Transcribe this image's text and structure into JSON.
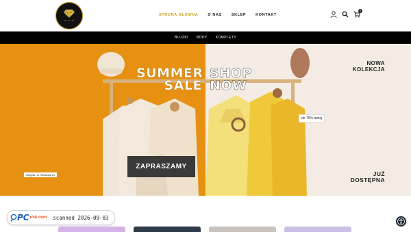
{
  "header": {
    "nav": [
      {
        "label": "STRONA GŁÓWNA",
        "active": true
      },
      {
        "label": "O NAS",
        "active": false
      },
      {
        "label": "SKLEP",
        "active": false
      },
      {
        "label": "KONTAKT",
        "active": false
      }
    ],
    "cart_count": "0",
    "icons": [
      "user-icon",
      "search-icon",
      "cart-icon"
    ]
  },
  "subnav": [
    "BLUZKI",
    "BODY",
    "KOMPLETY"
  ],
  "hero": {
    "headline_left": [
      "SUMMER",
      "SALE"
    ],
    "headline_right": [
      "SHOP",
      "NOW"
    ],
    "new_collection": [
      "NOWA",
      "KOLEKCJA"
    ],
    "available": [
      "JUŻ",
      "DOSTĘPNA"
    ],
    "promo": "do 70% taniej",
    "address": "Głogów, ul. Słodowa 14",
    "cta": "ZAPRASZAMY",
    "colors": {
      "left_bg": "#e69112",
      "right_bg": "#f4ece4",
      "cta_bg": "#3a3a3a"
    }
  },
  "watermark": {
    "brand_pc": "PC",
    "brand_risk": "risk.com",
    "scanned": "scanned 2026-09-03"
  },
  "colors": {
    "accent": "#c9a227",
    "subnav_bg": "#000000"
  }
}
